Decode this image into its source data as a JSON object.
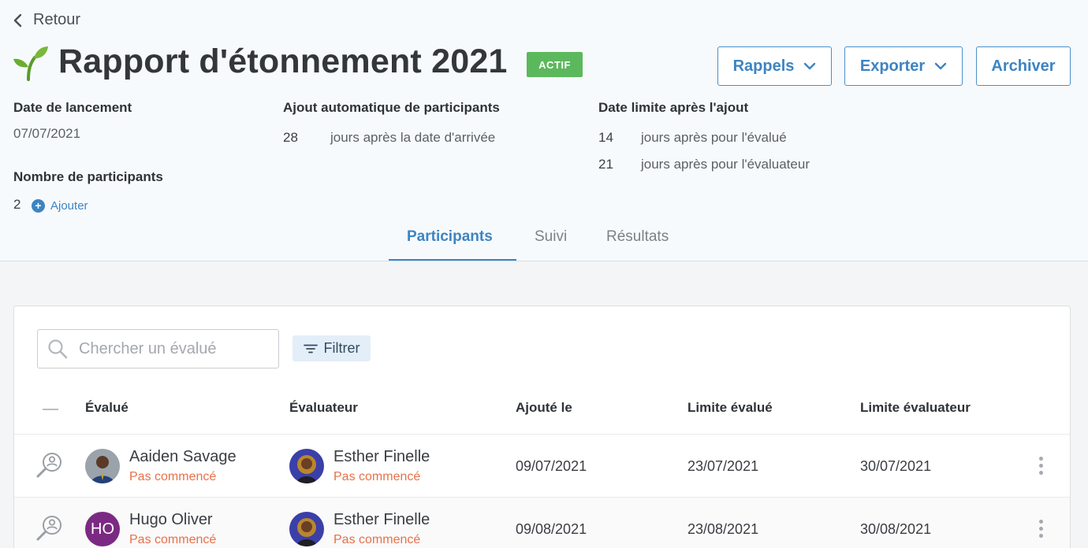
{
  "nav": {
    "back_label": "Retour"
  },
  "campaign": {
    "title": "Rapport d'étonnement 2021",
    "status_badge": "ACTIF",
    "actions": {
      "reminders": "Rappels",
      "export": "Exporter",
      "archive": "Archiver"
    }
  },
  "info": {
    "launch_label": "Date de lancement",
    "launch_date": "07/07/2021",
    "auto_add_label": "Ajout automatique de participants",
    "auto_add_days": "28",
    "auto_add_text": "jours après la date d'arrivée",
    "deadline_label": "Date limite après l'ajout",
    "deadline_evaluee_days": "14",
    "deadline_evaluee_text": "jours après pour l'évalué",
    "deadline_evaluator_days": "21",
    "deadline_evaluator_text": "jours après pour l'évaluateur",
    "participants_label": "Nombre de participants",
    "participants_count": "2",
    "add_label": "Ajouter"
  },
  "tabs": [
    {
      "label": "Participants",
      "active": true
    },
    {
      "label": "Suivi",
      "active": false
    },
    {
      "label": "Résultats",
      "active": false
    }
  ],
  "table": {
    "search_placeholder": "Chercher un évalué",
    "filter_label": "Filtrer",
    "headers": [
      "Évalué",
      "Évaluateur",
      "Ajouté le",
      "Limite évalué",
      "Limite évaluateur"
    ],
    "rows": [
      {
        "evaluee": {
          "name": "Aaiden Savage",
          "status": "Pas commencé"
        },
        "evaluator": {
          "name": "Esther Finelle",
          "status": "Pas commencé"
        },
        "added": "09/07/2021",
        "deadline_evaluee": "23/07/2021",
        "deadline_evaluator": "30/07/2021"
      },
      {
        "evaluee": {
          "name": "Hugo Oliver",
          "status": "Pas commencé",
          "initials": "HO"
        },
        "evaluator": {
          "name": "Esther Finelle",
          "status": "Pas commencé"
        },
        "added": "09/08/2021",
        "deadline_evaluee": "23/08/2021",
        "deadline_evaluator": "30/08/2021"
      }
    ]
  },
  "colors": {
    "accent": "#3d84c2",
    "badge_green": "#5cb85c",
    "status_orange": "#e8714a",
    "avatar_purple": "#7b2a83"
  }
}
